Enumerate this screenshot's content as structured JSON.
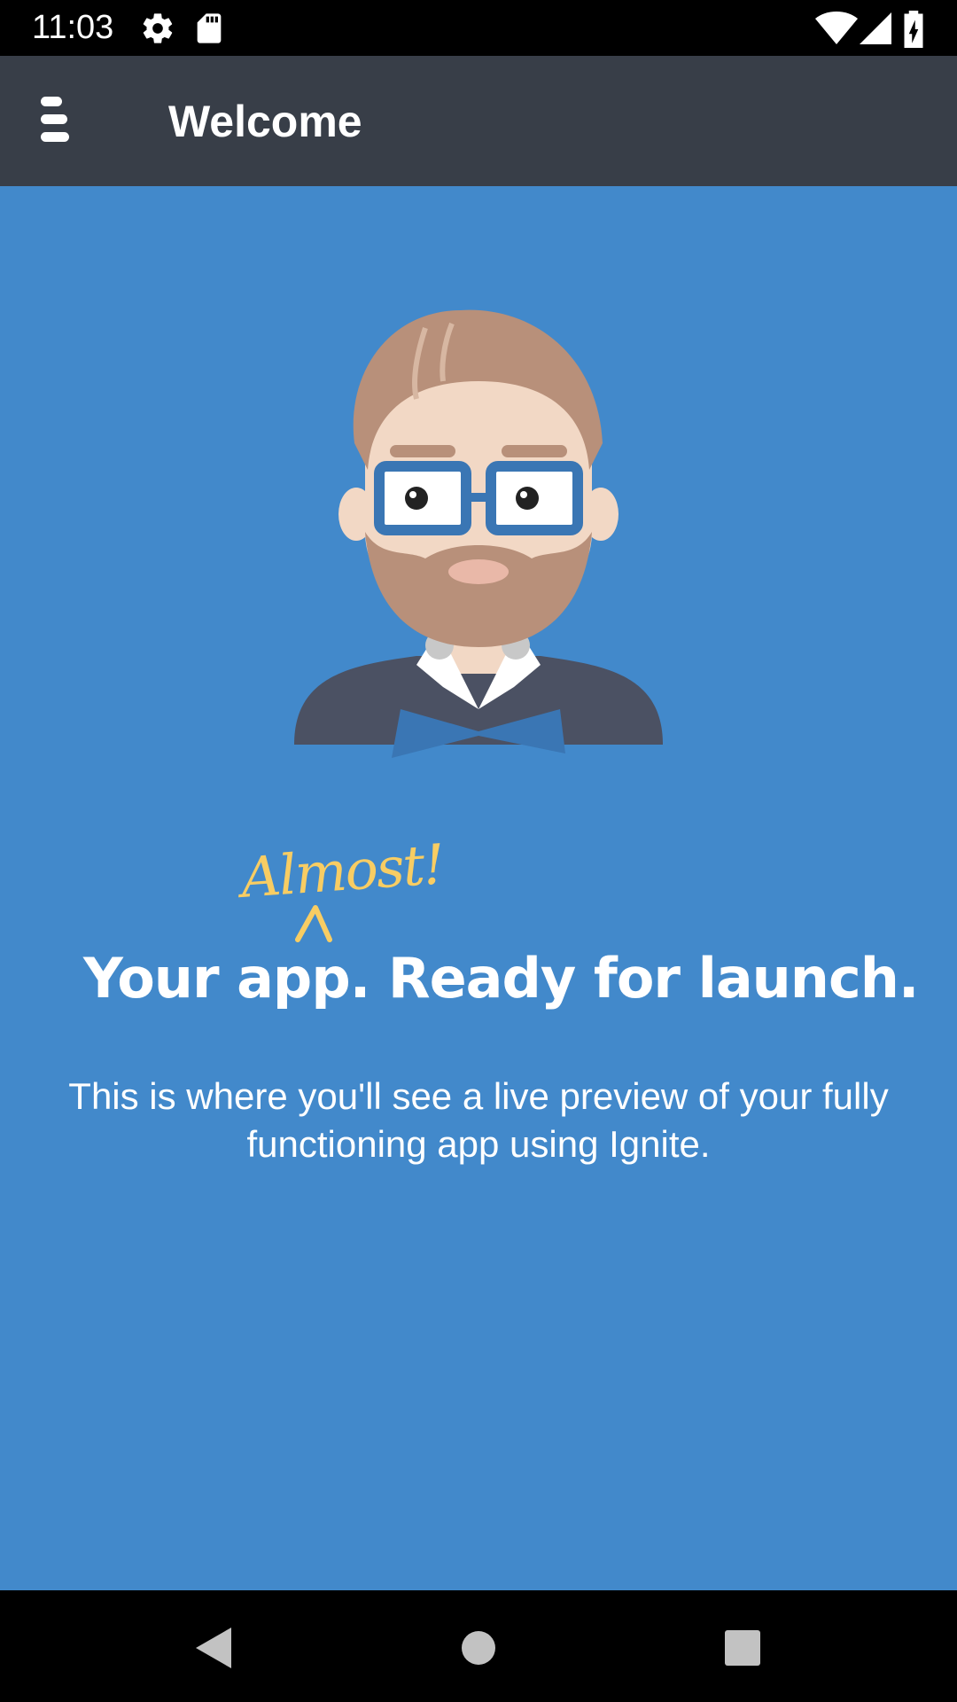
{
  "status_bar": {
    "time": "11:03",
    "icons": [
      "gear-icon",
      "sd-card-icon",
      "wifi-icon",
      "signal-icon",
      "battery-charging-icon"
    ]
  },
  "app_bar": {
    "title": "Welcome",
    "menu_icon": "hamburger-menu-icon"
  },
  "main": {
    "almost_text": "Almost!",
    "headline": "Your app. Ready for launch.",
    "subtext": "This is where you'll see a live preview of your fully functioning app using Ignite."
  },
  "nav_bar": {
    "buttons": [
      "back-icon",
      "home-icon",
      "recents-icon"
    ]
  },
  "colors": {
    "status_bar": "#000000",
    "app_bar": "#383e48",
    "background": "#4289cb",
    "accent": "#f8cd63",
    "text": "#ffffff"
  }
}
